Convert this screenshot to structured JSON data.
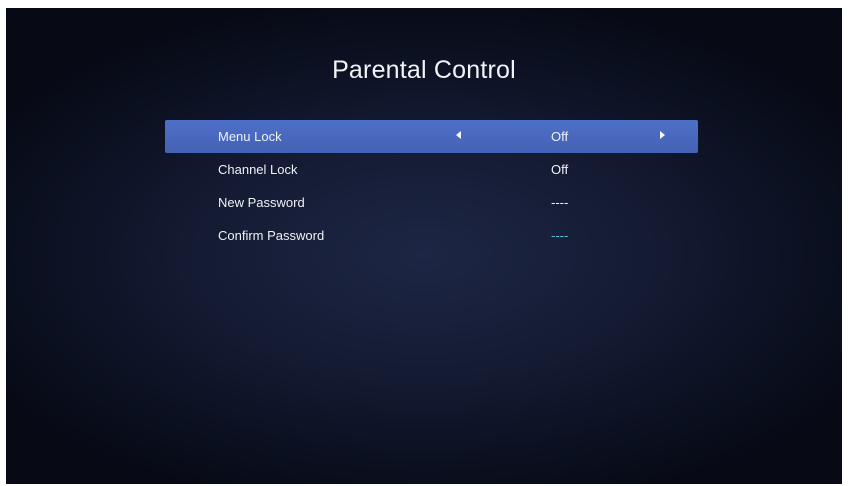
{
  "screen": {
    "title": "Parental Control"
  },
  "menu": {
    "items": [
      {
        "label": "Menu Lock",
        "value": "Off",
        "selected": true
      },
      {
        "label": "Channel Lock",
        "value": "Off",
        "selected": false
      },
      {
        "label": "New Password",
        "value": "----",
        "selected": false
      },
      {
        "label": "Confirm Password",
        "value": "----",
        "selected": false
      }
    ]
  },
  "colors": {
    "selection_bg": "#4a6abf",
    "value_accent": "#4fc3d9",
    "text": "#eef1f6"
  },
  "icons": {
    "prev": "arrow-left-icon",
    "next": "arrow-right-icon"
  }
}
